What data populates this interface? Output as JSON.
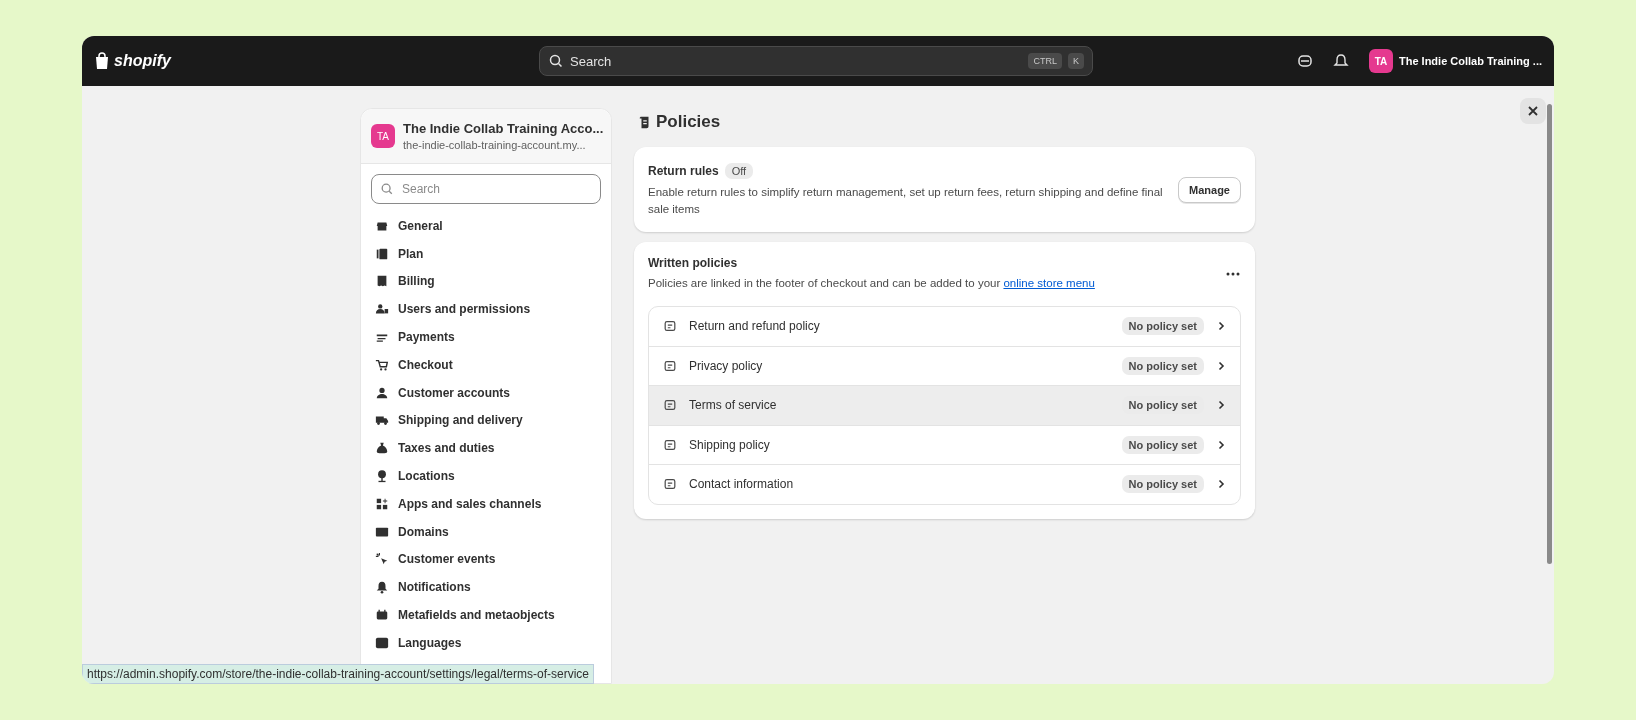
{
  "topbar": {
    "logo": "shopify",
    "search": {
      "placeholder": "Search",
      "shortcut": [
        "CTRL",
        "K"
      ]
    },
    "avatar": "TA",
    "store": "The Indie Collab Training ..."
  },
  "sidebar": {
    "avatar": "TA",
    "store_name": "The Indie Collab Training Acco...",
    "store_domain": "the-indie-collab-training-account.my...",
    "search": {
      "placeholder": "Search"
    },
    "items": [
      {
        "label": "General"
      },
      {
        "label": "Plan"
      },
      {
        "label": "Billing"
      },
      {
        "label": "Users and permissions"
      },
      {
        "label": "Payments"
      },
      {
        "label": "Checkout"
      },
      {
        "label": "Customer accounts"
      },
      {
        "label": "Shipping and delivery"
      },
      {
        "label": "Taxes and duties"
      },
      {
        "label": "Locations"
      },
      {
        "label": "Apps and sales channels"
      },
      {
        "label": "Domains"
      },
      {
        "label": "Customer events"
      },
      {
        "label": "Notifications"
      },
      {
        "label": "Metafields and metaobjects"
      },
      {
        "label": "Languages"
      }
    ]
  },
  "page": {
    "title": "Policies"
  },
  "return_rules": {
    "title": "Return rules",
    "status": "Off",
    "description": "Enable return rules to simplify return management, set up return fees, return shipping and define final sale items",
    "button": "Manage"
  },
  "written_policies": {
    "title": "Written policies",
    "description": "Policies are linked in the footer of checkout and can be added to your ",
    "link": "online store menu",
    "rows": [
      {
        "label": "Return and refund policy",
        "status": "No policy set",
        "hovered": false
      },
      {
        "label": "Privacy policy",
        "status": "No policy set",
        "hovered": false
      },
      {
        "label": "Terms of service",
        "status": "No policy set",
        "hovered": true
      },
      {
        "label": "Shipping policy",
        "status": "No policy set",
        "hovered": false
      },
      {
        "label": "Contact information",
        "status": "No policy set",
        "hovered": false
      }
    ]
  },
  "status_url": "https://admin.shopify.com/store/the-indie-collab-training-account/settings/legal/terms-of-service"
}
